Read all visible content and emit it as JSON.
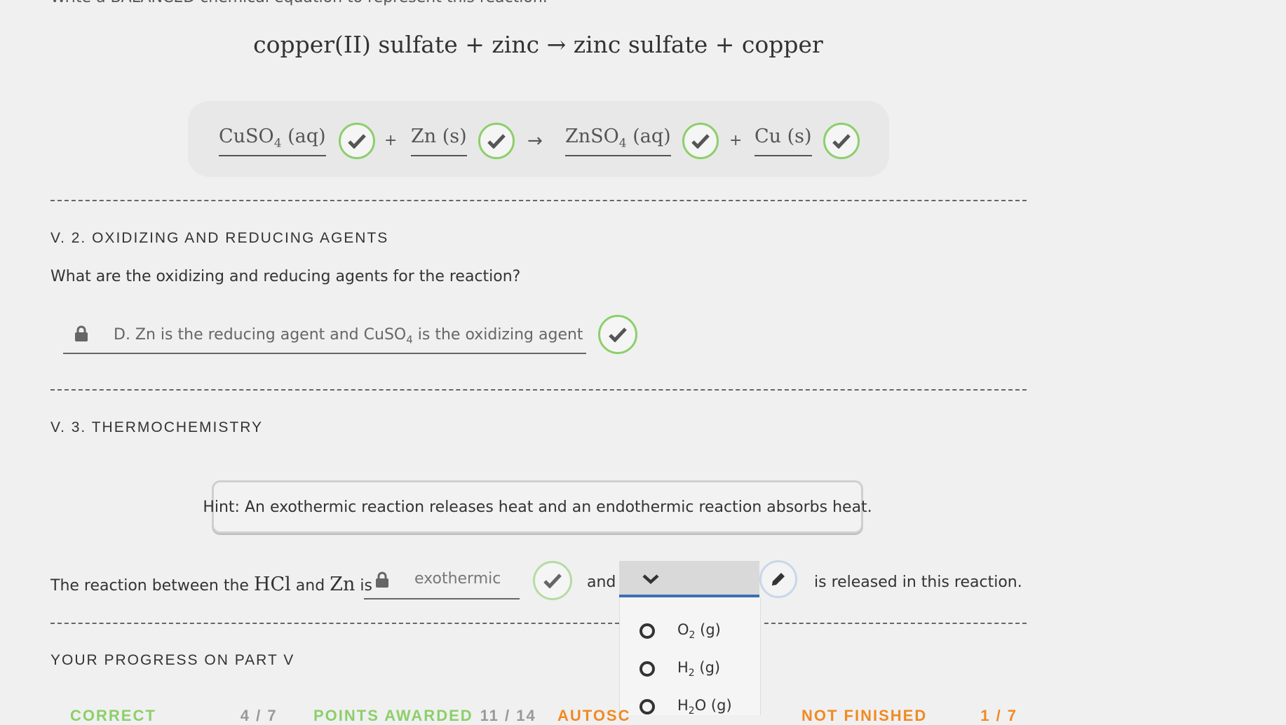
{
  "header": {
    "cut_text": "Write a BALANCED chemical equation to represent this reaction.",
    "word_equation": "copper(II) sulfate + zinc → zinc sulfate + copper"
  },
  "equation": {
    "terms": [
      {
        "formula": "CuSO",
        "sub": "4",
        "state": " (aq)"
      },
      {
        "formula": "Zn",
        "sub": "",
        "state": " (s)"
      },
      {
        "formula": "ZnSO",
        "sub": "4",
        "state": " (aq)"
      },
      {
        "formula": "Cu",
        "sub": "",
        "state": " (s)"
      }
    ],
    "plus": "+",
    "arrow": "→",
    "status_color": "#8ccf6a"
  },
  "section_agents": {
    "title": "V. 2. OXIDIZING AND REDUCING AGENTS",
    "question": "What are the oxidizing and reducing agents for the reaction?",
    "answer_pre": "D. Zn is the reducing agent and CuSO",
    "answer_sub": "4",
    "answer_post": " is the oxidizing agent"
  },
  "section_thermo": {
    "title": "V. 3. THERMOCHEMISTRY",
    "hint": "Hint: An exothermic reaction releases heat and an endothermic reaction absorbs heat.",
    "sentence_pre": "The reaction between the",
    "hcl": "HCl",
    "and_word": "and",
    "zn": "Zn",
    "is_word": "is",
    "answer": "exothermic",
    "and_connector": "and",
    "sentence_post": "is released in this reaction.",
    "dropdown_options": [
      {
        "pre": "O",
        "sub": "2",
        "post": " (g)"
      },
      {
        "pre": "H",
        "sub": "2",
        "post": " (g)"
      },
      {
        "pre": "H",
        "sub": "2",
        "post": "O (g)"
      }
    ],
    "dropdown_accent": "#3d6fb5"
  },
  "progress": {
    "title": "YOUR PROGRESS ON PART V",
    "items": [
      {
        "label": "CORRECT",
        "value": "4 / 7",
        "color": "#8ccf6a"
      },
      {
        "label": "POINTS AWARDED",
        "value": "11 / 14",
        "color": "#8ccf6a"
      },
      {
        "label": "AUTOSC",
        "value": "",
        "color": "#f08a24"
      },
      {
        "label": "NOT FINISHED",
        "value": "1 / 7",
        "color": "#f08a24"
      }
    ]
  }
}
